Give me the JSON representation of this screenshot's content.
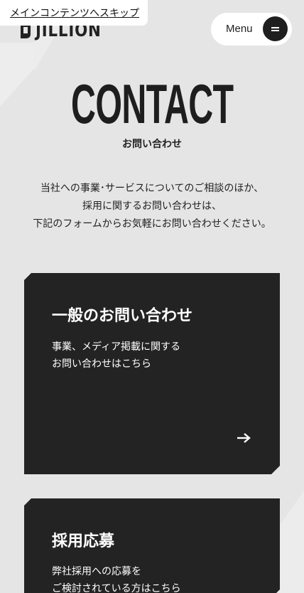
{
  "header": {
    "skip_link": "メインコンテンツへスキップ",
    "logo_text": "JILLION",
    "menu_label": "Menu",
    "menu_icon": "hamburger-icon"
  },
  "hero": {
    "title": "CONTACT",
    "subtitle": "お問い合わせ",
    "intro_lines": [
      "当社への事業･サービスについてのご相談のほか、",
      "採用に関するお問い合わせは、",
      "下記のフォームからお気軽にお問い合わせください。"
    ]
  },
  "cards": [
    {
      "title": "一般のお問い合わせ",
      "desc_lines": [
        "事業、メディア掲載に関する",
        "お問い合わせはこちら"
      ],
      "icon": "arrow-right-icon"
    },
    {
      "title": "採用応募",
      "desc_lines": [
        "弊社採用への応募を",
        "ご検討されている方はこちら"
      ]
    }
  ],
  "colors": {
    "background": "#e5e5e5",
    "card": "#232323",
    "text": "#222222",
    "pill": "#ffffff"
  }
}
